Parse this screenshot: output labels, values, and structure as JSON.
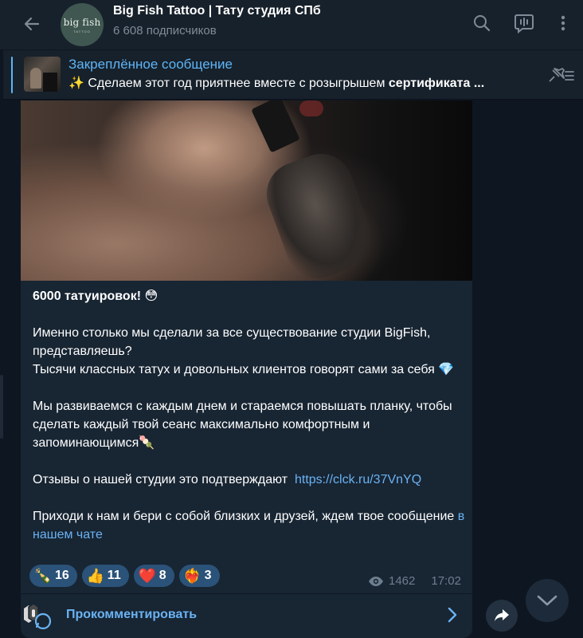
{
  "header": {
    "avatar_logo_text": "big fish",
    "avatar_logo_sub": "TATTOO",
    "title": "Big Fish Tattoo | Тату студия СПб",
    "subscribers": "6 608 подписчиков"
  },
  "pinned": {
    "title": "Закреплённое сообщение",
    "text_prefix": "✨ Сделаем этот год приятнее вместе с розыгрышем ",
    "text_bold": "сертификата ..."
  },
  "message": {
    "heading": "6000 татуировок!",
    "heading_emoji": "😳",
    "p1": "Именно столько мы сделали за все существование студии BigFish, представляешь?",
    "p2": "Тысячи классных татух и довольных клиентов говорят сами за себя",
    "p2_emoji": "💎",
    "p3": "Мы развиваемся с каждым днем и стараемся повышать планку, чтобы сделать каждый твой сеанс максимально комфортным и запоминающимся",
    "p3_emoji": "🍡",
    "p4_text": "Отзывы о нашей студии это подтверждают",
    "p4_link": "https://clck.ru/37VnYQ",
    "p5_text": "Приходи к нам и бери с собой близких и друзей, ждем твое сообщение",
    "p5_link": "в нашем чате"
  },
  "reactions": [
    {
      "emoji": "🍾",
      "count": "16"
    },
    {
      "emoji": "👍",
      "count": "11"
    },
    {
      "emoji": "❤️",
      "count": "8"
    },
    {
      "emoji": "❤️‍🔥",
      "count": "3"
    }
  ],
  "meta": {
    "views": "1462",
    "time": "17:02"
  },
  "comments": {
    "label": "Прокомментировать"
  },
  "colors": {
    "background": "#0e1621",
    "header": "#17212b",
    "bubble": "#182533",
    "accent": "#5eb5f7",
    "link": "#6ab3f3",
    "reaction_bg": "#2b5278"
  }
}
